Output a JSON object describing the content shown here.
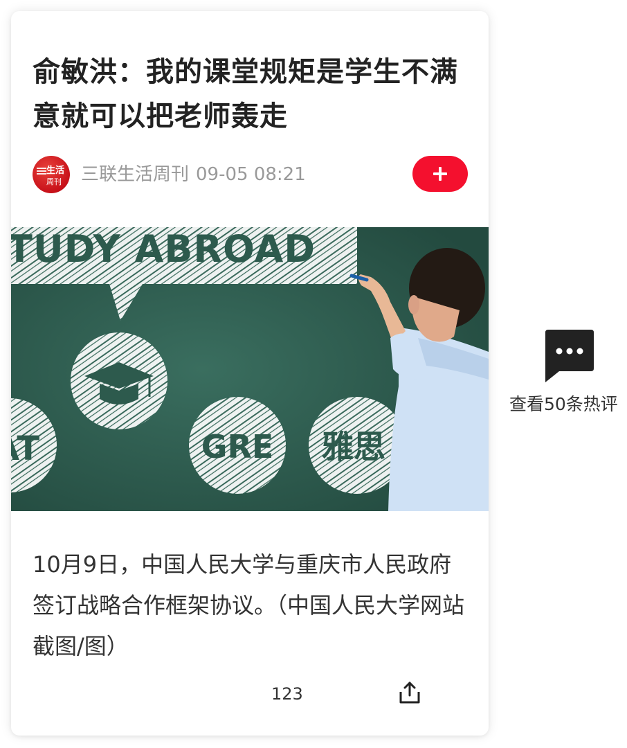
{
  "article": {
    "title": "俞敏洪：我的课堂规矩是学生不满意就可以把老师轰走",
    "source_name": "三联生活周刊",
    "publish_time": "09-05 08:21",
    "avatar_text_line1": "生活",
    "avatar_text_line2": "周刊",
    "follow_button_icon": "plus-icon",
    "image_texts": {
      "banner": "TUDY ABROAD",
      "left_circle": "AT",
      "middle_circle": "GRE",
      "right_circle": "雅思"
    },
    "caption": "10月9日，中国人民大学与重庆市人民政府签订战略合作框架协议。（中国人民大学网站截图/图）",
    "engagement_count": "123",
    "share_icon": "share-icon"
  },
  "comments": {
    "label": "查看50条热评",
    "icon": "speech-bubble-dots-icon"
  },
  "colors": {
    "accent_red": "#f4102e",
    "avatar_red": "#c8111a",
    "chalkboard_green": "#2f5e50",
    "title_text": "#222222",
    "meta_text": "#999999"
  }
}
